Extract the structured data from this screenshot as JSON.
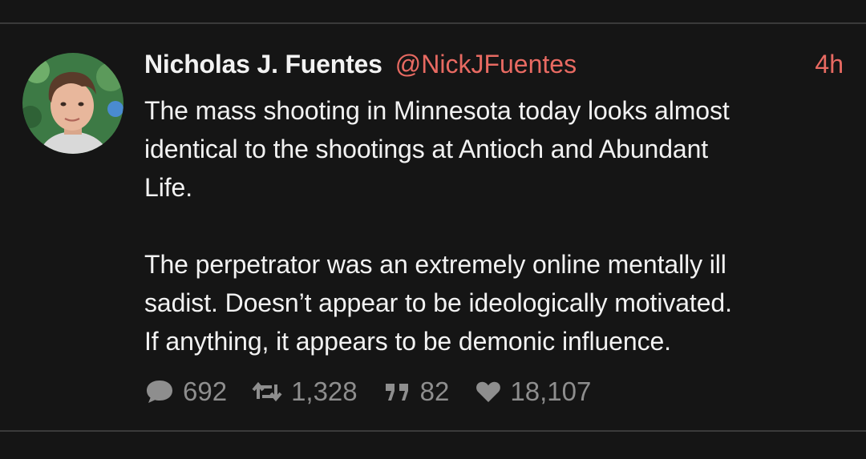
{
  "tweet": {
    "author_name": "Nicholas J. Fuentes",
    "handle": "@NickJFuentes",
    "time": "4h",
    "paragraphs": [
      "The mass shooting in Minnesota today looks almost\nidentical to the shootings at Antioch and Abundant\nLife.",
      "The perpetrator was an extremely online mentally ill\nsadist. Doesn’t appear to be ideologically motivated.\nIf anything, it appears to be demonic influence."
    ],
    "stats": {
      "replies": "692",
      "retweets": "1,328",
      "quotes": "82",
      "likes": "18,107"
    }
  },
  "icons": {
    "reply": "comment-bubble-icon",
    "retweet": "retweet-icon",
    "quote": "quote-icon",
    "like": "heart-icon"
  },
  "colors": {
    "background": "#151515",
    "text": "#f2f2f2",
    "accent": "#e86a62",
    "muted": "#8e8e8e",
    "divider": "#3a3a3a"
  }
}
